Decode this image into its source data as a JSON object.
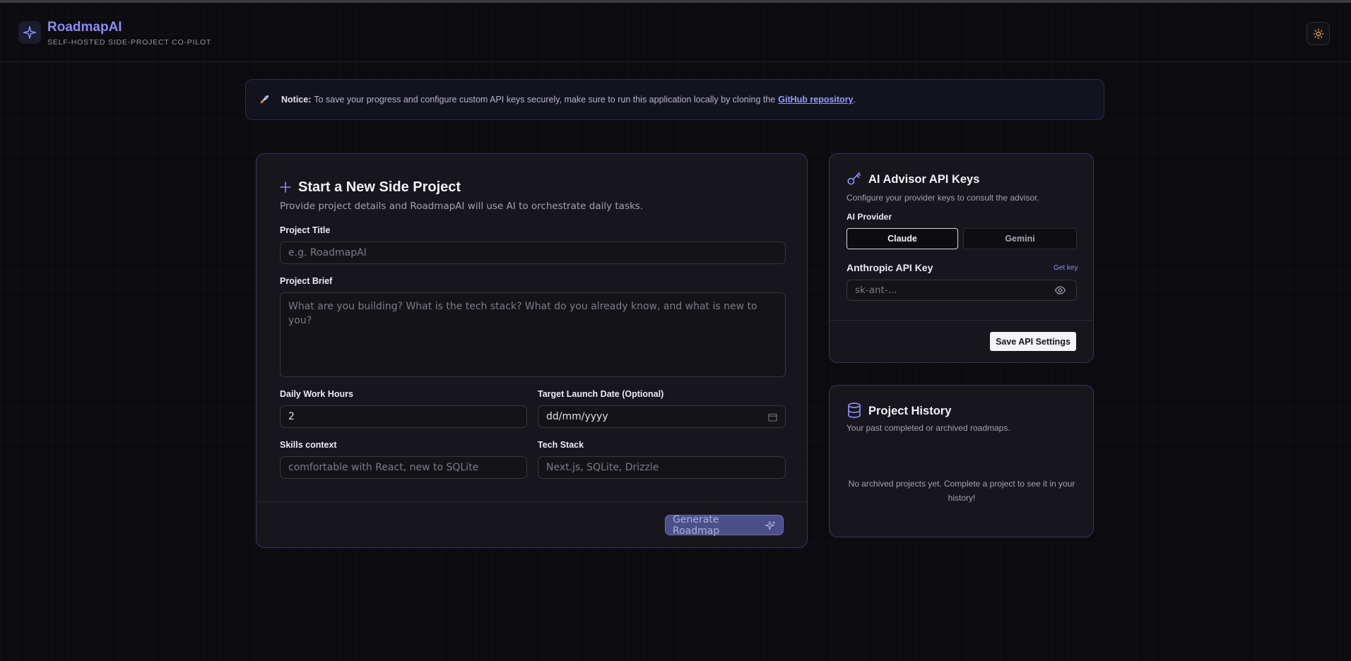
{
  "header": {
    "brand_name": "RoadmapAI",
    "brand_subtitle": "SELF-HOSTED SIDE-PROJECT CO-PILOT",
    "theme_icon": "sun-icon"
  },
  "notice": {
    "label": "Notice:",
    "text": "To save your progress and configure custom API keys securely, make sure to run this application locally by cloning the",
    "link_text": "GitHub repository",
    "end": "."
  },
  "new_project": {
    "title": "Start a New Side Project",
    "description": "Provide project details and RoadmapAI will use AI to orchestrate daily tasks.",
    "title_label": "Project Title",
    "title_placeholder": "e.g. RoadmapAI",
    "brief_label": "Project Brief",
    "brief_placeholder": "What are you building? What is the tech stack? What do you already know, and what is new to you?",
    "hours_label": "Daily Work Hours",
    "hours_value": "2",
    "date_label": "Target Launch Date (Optional)",
    "date_placeholder": "dd/mm/yyyy",
    "skills_label": "Skills context",
    "skills_placeholder": "comfortable with React, new to SQLite",
    "stack_label": "Tech Stack",
    "stack_placeholder": "Next.js, SQLite, Drizzle",
    "generate_button": "Generate Roadmap"
  },
  "api_keys": {
    "title": "AI Advisor API Keys",
    "description": "Configure your provider keys to consult the advisor.",
    "provider_label": "AI Provider",
    "providers": [
      "Claude",
      "Gemini"
    ],
    "selected_provider": "Claude",
    "key_label": "Anthropic API Key",
    "get_key_link": "Get key",
    "key_placeholder": "sk-ant-...",
    "save_button": "Save API Settings"
  },
  "history": {
    "title": "Project History",
    "description": "Your past completed or archived roadmaps.",
    "empty_message": "No archived projects yet. Complete a project to see it in your history!"
  },
  "colors": {
    "accent": "#8b8cf6",
    "background": "#0c0b0f",
    "card_border": "#33345e"
  }
}
